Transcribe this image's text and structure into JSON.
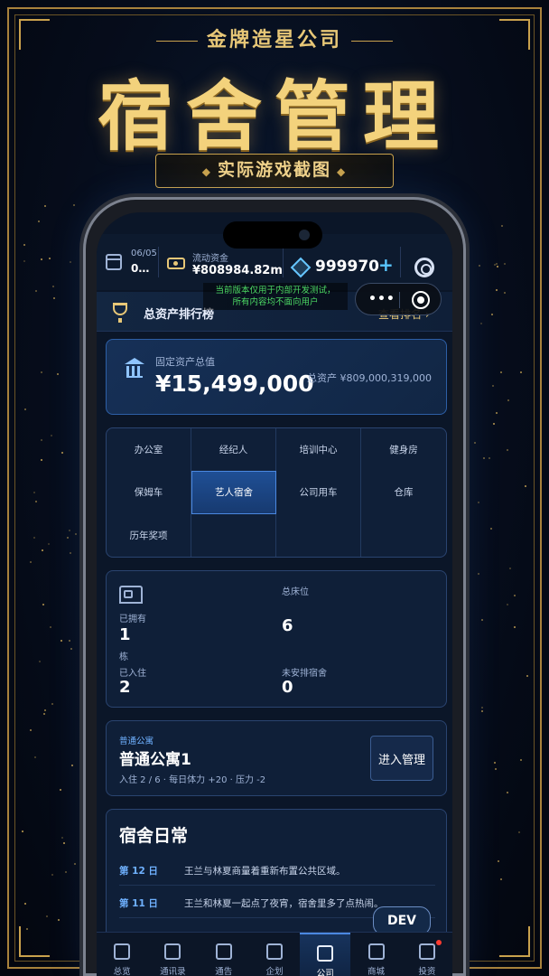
{
  "poster": {
    "subtitle": "金牌造星公司",
    "title": "宿舍管理",
    "tag": "实际游戏截图"
  },
  "status": {
    "date": "06/05",
    "date_line2": "0…",
    "cash_label": "流动资金",
    "cash_value": "¥808984.82m",
    "gems": "999970",
    "gems_plus": "+"
  },
  "dev_notice": {
    "line1": "当前版本仅用于内部开发测试，",
    "line2": "所有内容均不面向用户"
  },
  "capsule": {
    "more": "•••"
  },
  "ranking": {
    "title": "总资产排行榜",
    "link": "查看排名 ›"
  },
  "assets": {
    "fixed_label": "固定资产总值",
    "fixed_value": "¥15,499,000",
    "total": "总资产 ¥809,000,319,000"
  },
  "categories": [
    "办公室",
    "经纪人",
    "培训中心",
    "健身房",
    "保姆车",
    "艺人宿舍",
    "公司用车",
    "仓库",
    "历年奖项",
    "",
    "",
    ""
  ],
  "active_category": "艺人宿舍",
  "stats": {
    "owned_label": "已拥有",
    "owned_value": "1",
    "owned_unit": "栋",
    "beds_label": "总床位",
    "beds_value": "6",
    "checked_in_label": "已入住",
    "checked_in_value": "2",
    "unassigned_label": "未安排宿舍",
    "unassigned_value": "0"
  },
  "apartment": {
    "type": "普通公寓",
    "name": "普通公寓1",
    "info": "入住 2 / 6 · 每日体力 +20 · 压力 -2",
    "button": "进入管理"
  },
  "daily": {
    "title": "宿舍日常",
    "entries": [
      {
        "day": "第 12 日",
        "text": "王兰与林夏商量着重新布置公共区域。"
      },
      {
        "day": "第 11 日",
        "text": "王兰和林夏一起点了夜宵，宿舍里多了点热闹。"
      }
    ]
  },
  "dev_button": "DEV",
  "nav": [
    {
      "label": "总览",
      "icon": "grid-icon"
    },
    {
      "label": "通讯录",
      "icon": "contacts-icon"
    },
    {
      "label": "通告",
      "icon": "clapper-icon"
    },
    {
      "label": "企划",
      "icon": "clipboard-icon"
    },
    {
      "label": "公司",
      "icon": "building-icon",
      "active": true
    },
    {
      "label": "商城",
      "icon": "bag-icon"
    },
    {
      "label": "投资",
      "icon": "chart-icon",
      "badge": true
    }
  ],
  "colors": {
    "gold": "#e7c777",
    "accent_blue": "#4b88e0",
    "dev_green": "#4cd964",
    "badge_red": "#ff3b30"
  }
}
